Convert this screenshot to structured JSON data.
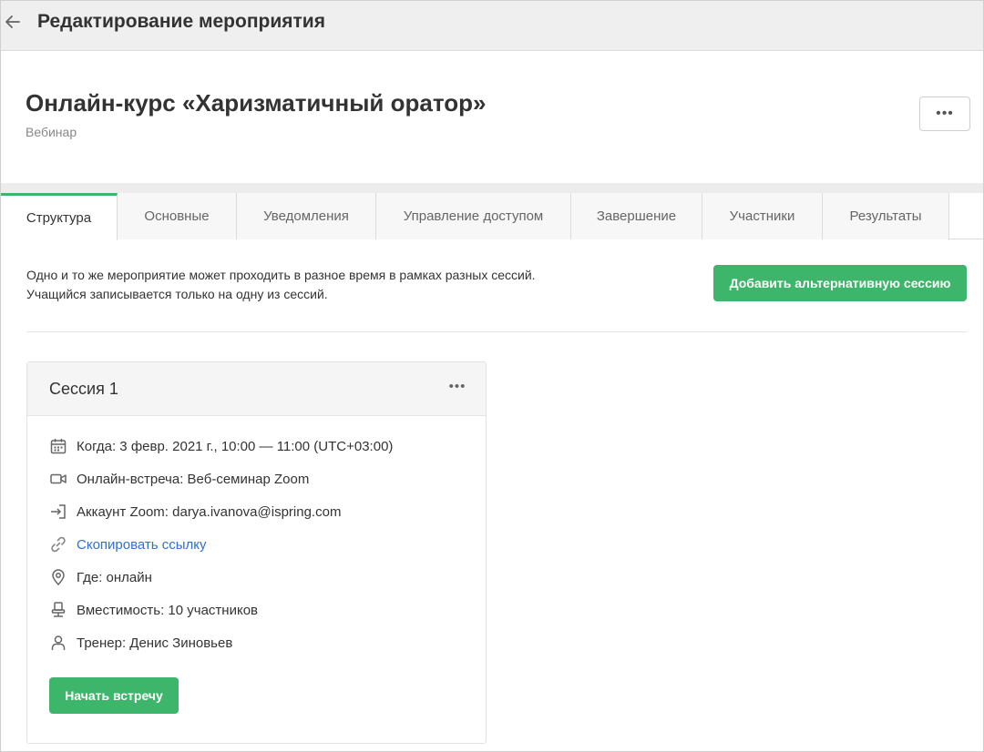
{
  "header": {
    "title": "Редактирование мероприятия"
  },
  "event": {
    "title": "Онлайн-курс «Харизматичный оратор»",
    "type": "Вебинар",
    "more_label": "•••"
  },
  "tabs": [
    {
      "label": "Структура",
      "active": true
    },
    {
      "label": "Основные"
    },
    {
      "label": "Уведомления"
    },
    {
      "label": "Управление доступом"
    },
    {
      "label": "Завершение"
    },
    {
      "label": "Участники"
    },
    {
      "label": "Результаты"
    }
  ],
  "structure": {
    "info_line1": "Одно и то же мероприятие может проходить в разное время в рамках разных сессий.",
    "info_line2": "Учащийся записывается только на одну из сессий.",
    "add_session_label": "Добавить альтернативную сессию"
  },
  "session": {
    "title": "Сессия 1",
    "more_label": "•••",
    "details": [
      {
        "icon": "calendar-icon",
        "text": "Когда: 3 февр. 2021 г., 10:00 — 11:00 (UTC+03:00)"
      },
      {
        "icon": "video-camera-icon",
        "text": "Онлайн-встреча: Веб-семинар Zoom"
      },
      {
        "icon": "login-icon",
        "text": "Аккаунт Zoom: darya.ivanova@ispring.com"
      },
      {
        "icon": "link-icon",
        "text": "Скопировать ссылку"
      },
      {
        "icon": "location-pin-icon",
        "text": "Где: онлайн"
      },
      {
        "icon": "chair-icon",
        "text": "Вместимость: 10 участников"
      },
      {
        "icon": "user-icon",
        "text": "Тренер: Денис Зиновьев"
      }
    ],
    "start_label": "Начать встречу"
  },
  "colors": {
    "accent": "#3db56a",
    "link": "#2f6fd6"
  }
}
